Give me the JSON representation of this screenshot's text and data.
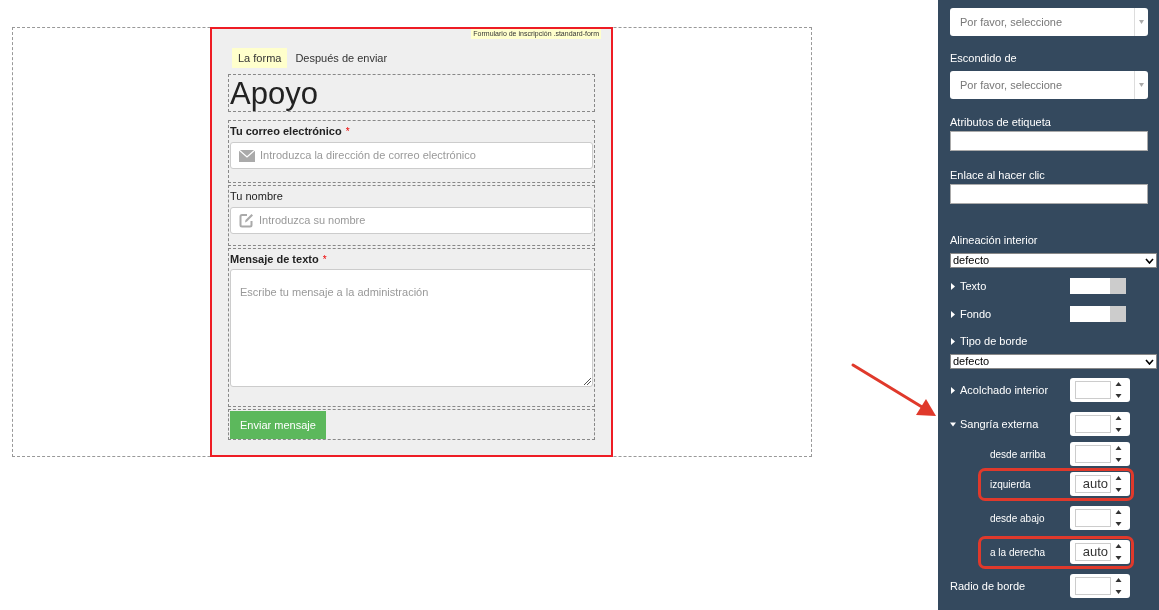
{
  "form": {
    "tag": "Formulario de inscripción .standard-form",
    "tabs": [
      {
        "label": "La forma",
        "selected": true
      },
      {
        "label": "Después de enviar",
        "selected": false
      }
    ],
    "title": "Apoyo",
    "fields": [
      {
        "kind": "email",
        "label": "Tu correo electrónico",
        "required": true,
        "placeholder": "Introduzca la dirección de correo electrónico"
      },
      {
        "kind": "name",
        "label": "Tu nombre",
        "required": false,
        "placeholder": "Introduzca su nombre"
      },
      {
        "kind": "textarea",
        "label": "Mensaje de texto",
        "required": true,
        "placeholder": "Escribe tu mensaje a la administración"
      }
    ],
    "required_mark": "*",
    "submit": "Enviar mensaje"
  },
  "panel": {
    "rows": [
      {
        "kind": "select",
        "placeholder": "Por favor, seleccione"
      },
      {
        "kind": "select",
        "label": "Escondido de",
        "placeholder": "Por favor, seleccione"
      },
      {
        "kind": "text",
        "label": "Atributos de etiqueta"
      },
      {
        "kind": "text",
        "label": "Enlace al hacer clic"
      },
      {
        "kind": "dropdown",
        "label": "Alineación interior",
        "value": "defecto"
      },
      {
        "kind": "color",
        "label": "Texto",
        "expanded": false
      },
      {
        "kind": "color",
        "label": "Fondo",
        "expanded": false
      },
      {
        "kind": "dropdown",
        "label": "Tipo de borde",
        "value": "defecto",
        "expanded": false
      },
      {
        "kind": "spinner",
        "label": "Acolchado interior",
        "expanded": false
      },
      {
        "kind": "spinner",
        "label": "Sangría externa",
        "expanded": true,
        "children": [
          {
            "label": "desde arriba",
            "highlighted": false
          },
          {
            "label": "izquierda",
            "value": "auto",
            "highlighted": true
          },
          {
            "label": "desde abajo",
            "highlighted": false
          },
          {
            "label": "a la derecha",
            "value": "auto",
            "highlighted": true
          }
        ]
      },
      {
        "kind": "spinner",
        "label": "Radio de borde"
      }
    ]
  }
}
